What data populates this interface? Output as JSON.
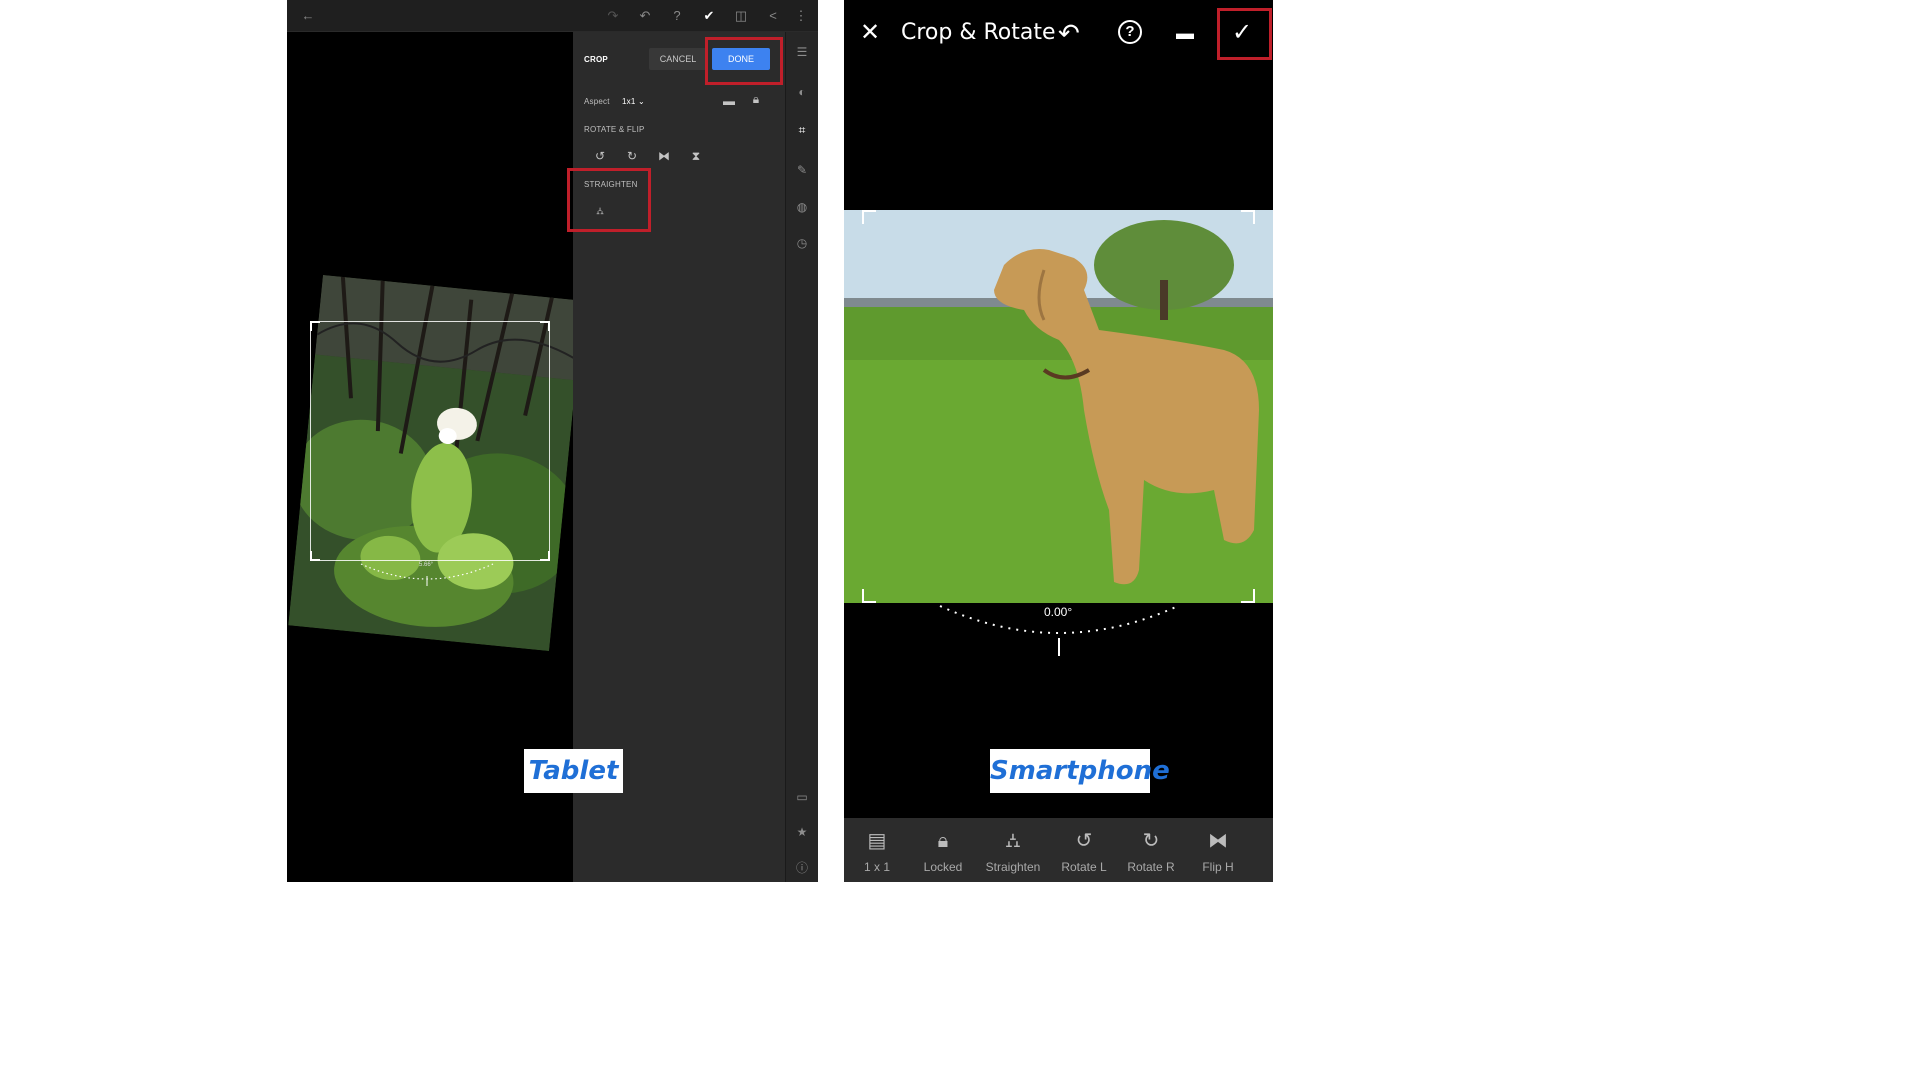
{
  "tablet": {
    "panel": {
      "section_title": "CROP",
      "cancel_label": "CANCEL",
      "done_label": "DONE",
      "aspect_label": "Aspect",
      "aspect_value": "1x1",
      "rotate_flip_label": "ROTATE & FLIP",
      "straighten_label": "STRAIGHTEN"
    },
    "angle": "5.66°",
    "caption": "Tablet"
  },
  "phone": {
    "title": "Crop & Rotate",
    "angle": "0.00°",
    "caption": "Smartphone",
    "tools": [
      {
        "label": "1 x 1",
        "icon": "aspect-icon"
      },
      {
        "label": "Locked",
        "icon": "lock-icon"
      },
      {
        "label": "Straighten",
        "icon": "straighten-icon"
      },
      {
        "label": "Rotate L",
        "icon": "rotate-left-icon"
      },
      {
        "label": "Rotate R",
        "icon": "rotate-right-icon"
      },
      {
        "label": "Flip H",
        "icon": "flip-horizontal-icon"
      }
    ]
  },
  "colors": {
    "highlight": "#c01f2a",
    "done_button": "#3d82f0",
    "caption_text": "#1f6fd6"
  }
}
